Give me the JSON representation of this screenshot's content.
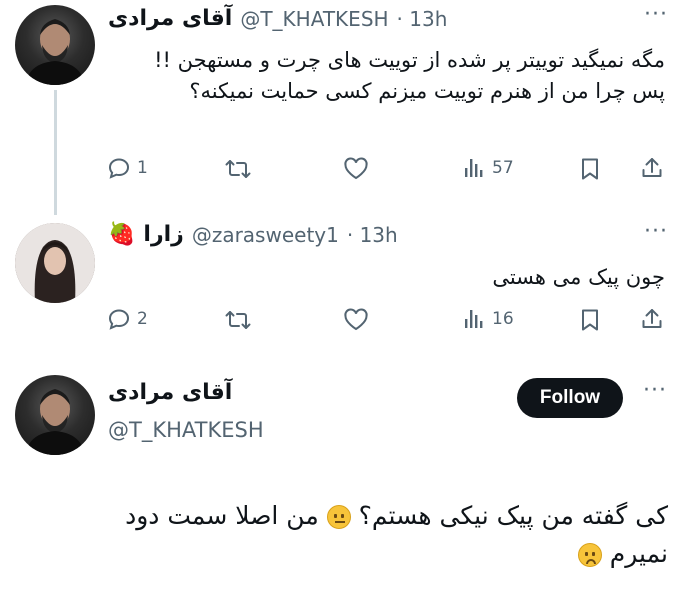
{
  "tweet1": {
    "display_name": "آقای مرادی",
    "handle": "@T_KHATKESH",
    "time": "· 13h",
    "text": "مگه نمیگید توییتر پر شده از توییت های چرت و مستهجن !! پس چرا من از هنرم توییت میزنم کسی حمایت نمیکنه؟",
    "replies": "1",
    "views": "57"
  },
  "tweet2": {
    "display_name": "زارا",
    "handle": "@zarasweety1",
    "time": "· 13h",
    "name_emoji": "🍓",
    "text": "چون پیک می هستی",
    "replies": "2",
    "views": "16"
  },
  "main": {
    "display_name": "آقای مرادی",
    "handle": "@T_KHATKESH",
    "follow_label": "Follow",
    "text_part1": "کی گفته من پیک نیکی هستم؟",
    "text_part2": "من اصلا سمت دود",
    "text_part3": "نمیرم",
    "emoji1": "😐",
    "emoji2": "🙁"
  },
  "icons": [
    "reply-icon",
    "retweet-icon",
    "like-icon",
    "views-icon",
    "bookmark-icon",
    "share-icon",
    "more-icon"
  ],
  "colors": {
    "text": "#0f1419",
    "secondary": "#536471",
    "follow_bg": "#0f1419",
    "thread_line": "#cfd9de"
  }
}
